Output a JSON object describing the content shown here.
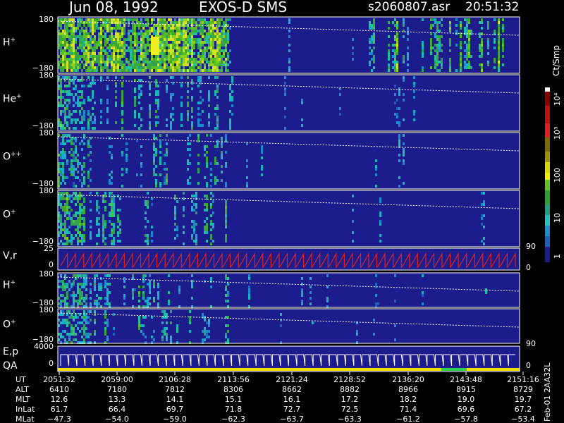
{
  "header": {
    "date": "Jun 08, 1992",
    "instrument": "EXOS-D SMS",
    "file": "s2060807.asr",
    "time": "20:51:32"
  },
  "chart_data": {
    "type": "heatmap",
    "panels": [
      {
        "label_main": "H",
        "label_sup": "+",
        "ytop": "180",
        "ybottom": "−180"
      },
      {
        "label_main": "He",
        "label_sup": "+",
        "ytop": "180",
        "ybottom": "−180"
      },
      {
        "label_main": "O",
        "label_sup": "++",
        "ytop": "180",
        "ybottom": "−180"
      },
      {
        "label_main": "O",
        "label_sup": "+",
        "ytop": "180",
        "ybottom": "−180"
      },
      {
        "label_main": "V,r",
        "label_sup": "",
        "ytop": "25",
        "ymid": "0",
        "rtop": "90",
        "rbottom": "0"
      },
      {
        "label_main": "H",
        "label_sup": "+",
        "ytop": "180",
        "ybottom": "−180"
      },
      {
        "label_main": "O",
        "label_sup": "+",
        "ytop": "180",
        "ybottom": "−180",
        "rbottom": "90"
      },
      {
        "label_main": "E,p",
        "label_sub": "QA",
        "ytop": "4000",
        "ymid": "0",
        "rbottom": "0"
      }
    ],
    "colorbar": {
      "unit": "Ct/Smp",
      "ticks": [
        "10⁴",
        "10³",
        "100",
        "10",
        "1"
      ]
    },
    "ephemeris": {
      "rows": [
        {
          "name": "UT",
          "values": [
            "2051:32",
            "2059:00",
            "2106:28",
            "2113:56",
            "2121:24",
            "2128:52",
            "2136:20",
            "2143:48",
            "2151:16"
          ]
        },
        {
          "name": "ALT",
          "values": [
            "6410",
            "7180",
            "7812",
            "8306",
            "8662",
            "8882",
            "8966",
            "8915",
            "8729"
          ]
        },
        {
          "name": "MLT",
          "values": [
            "12.6",
            "13.3",
            "14.1",
            "15.1",
            "16.1",
            "17.2",
            "18.2",
            "19.0",
            "19.7"
          ]
        },
        {
          "name": "InLat",
          "values": [
            "61.7",
            "66.4",
            "69.7",
            "71.8",
            "72.7",
            "72.5",
            "71.4",
            "69.6",
            "67.2"
          ]
        },
        {
          "name": "MLat",
          "values": [
            "−47.3",
            "−54.0",
            "−59.0",
            "−62.3",
            "−63.7",
            "−63.3",
            "−61.2",
            "−57.8",
            "−53.4"
          ]
        }
      ]
    },
    "footer_note": "Feb-01 2AA32L"
  },
  "colors": {
    "background": "#1c1c8c",
    "frame": "#ffffff",
    "red_trace": "#e02020",
    "qa_yellow": "#f0e000",
    "qa_green": "#30d050"
  }
}
